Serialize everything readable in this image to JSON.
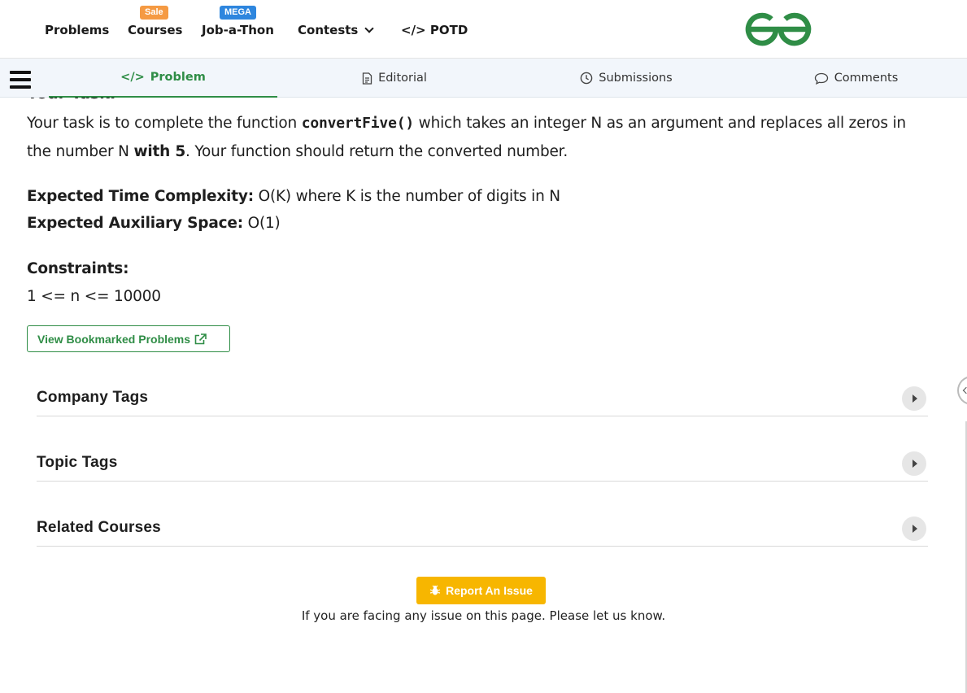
{
  "nav": {
    "items": [
      {
        "label": "Problems"
      },
      {
        "label": "Courses",
        "badge": "Sale"
      },
      {
        "label": "Job-a-Thon",
        "badge": "MEGA"
      },
      {
        "label": "Contests"
      },
      {
        "label": "POTD",
        "icon": "code-icon"
      }
    ],
    "logo_icon": "gfg-logo",
    "colors": {
      "brand_green": "#2f8d46",
      "sale_badge": "#f59a43",
      "mega_badge": "#2e86de"
    }
  },
  "tabs": [
    {
      "label": "Problem",
      "icon": "code-icon",
      "active": true
    },
    {
      "label": "Editorial",
      "icon": "document-icon"
    },
    {
      "label": "Submissions",
      "icon": "clock-icon"
    },
    {
      "label": "Comments",
      "icon": "comment-icon"
    }
  ],
  "content": {
    "task_heading": "Your Task:",
    "task_p1": "Your task is to complete the function ",
    "task_fn": "convertFive()",
    "task_p2": " which takes an integer N as an argument and replaces all zeros in the number N ",
    "task_with5": "with 5",
    "task_p3": ". Your function should return the converted number.",
    "time_label": "Expected Time Complexity:",
    "time_value": " O(K) where K is the number of digits in N",
    "space_label": "Expected Auxiliary Space:",
    "space_value": " O(1)",
    "constraints_label": "Constraints:",
    "constraints_value": "1 <= n <= 10000",
    "bookmark_button": "View Bookmarked Problems"
  },
  "accordions": [
    {
      "title": "Company Tags"
    },
    {
      "title": "Topic Tags"
    },
    {
      "title": "Related Courses"
    }
  ],
  "report": {
    "button": "Report An Issue",
    "note": "If you are facing any issue on this page. Please let us know.",
    "color": "#f7b600"
  }
}
